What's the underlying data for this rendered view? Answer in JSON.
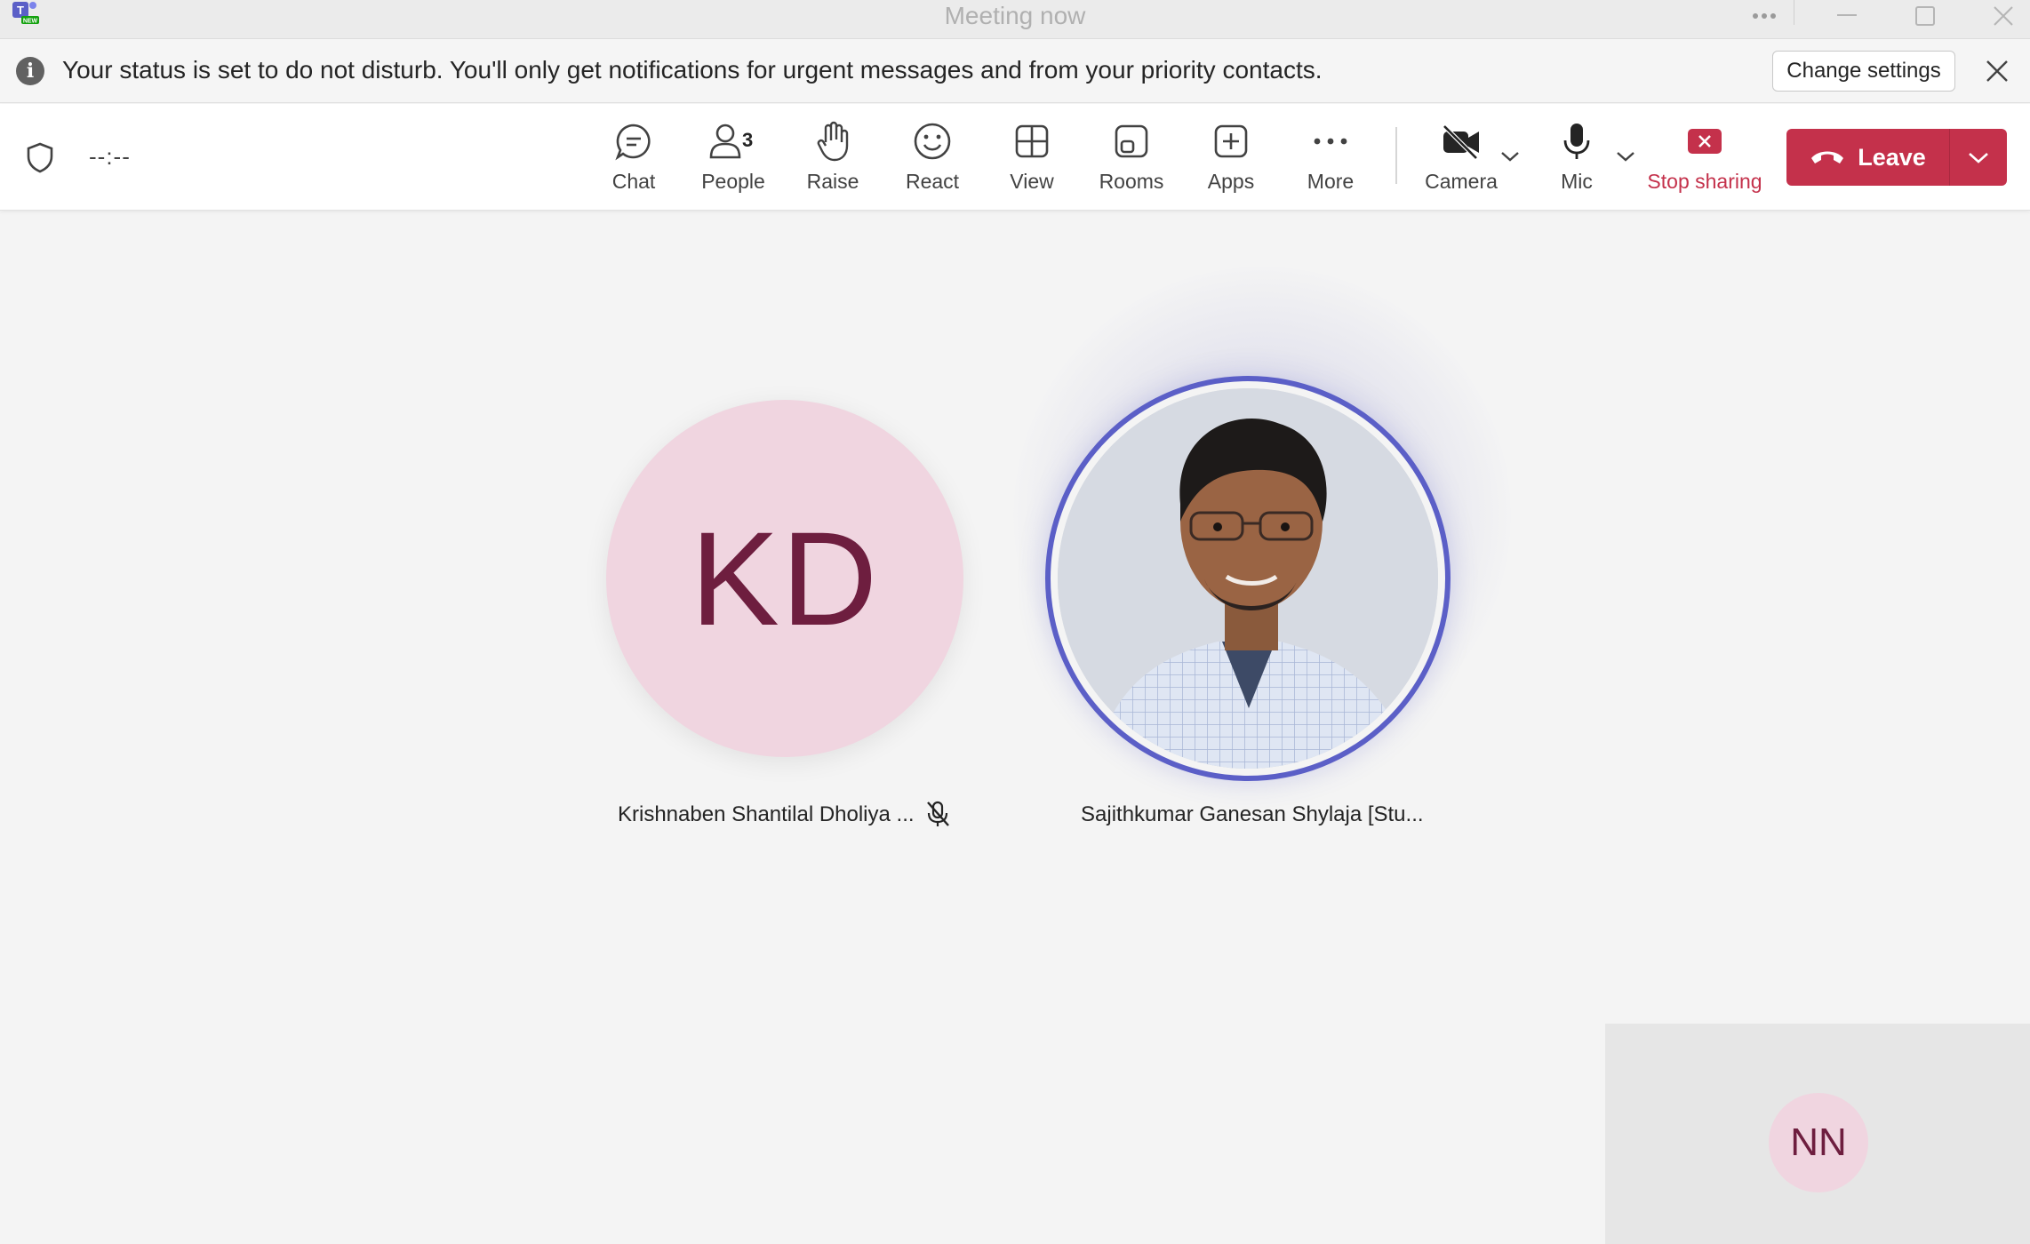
{
  "window": {
    "title": "Meeting now",
    "logo_badge": "NEW"
  },
  "banner": {
    "icon": "info-icon",
    "text": "Your status is set to do not disturb. You'll only get notifications for urgent messages and from your priority contacts.",
    "change_settings": "Change settings"
  },
  "toolbar": {
    "timer": "--:--",
    "chat": "Chat",
    "people": "People",
    "people_count": "3",
    "raise": "Raise",
    "react": "React",
    "view": "View",
    "rooms": "Rooms",
    "apps": "Apps",
    "more": "More",
    "camera": "Camera",
    "mic": "Mic",
    "stop_sharing": "Stop sharing",
    "leave": "Leave"
  },
  "participants": [
    {
      "initials": "KD",
      "name": "Krishnaben Shantilal Dholiya ...",
      "muted": true,
      "avatar_color": "#f0d5e0"
    },
    {
      "name": "Sajithkumar Ganesan Shylaja [Stu...",
      "speaking": true,
      "ring_color": "#5b5fc7"
    }
  ],
  "self": {
    "initials": "NN"
  },
  "colors": {
    "accent": "#5b5fc7",
    "leave": "#c4314b",
    "initials_text": "#6e1e3f"
  }
}
